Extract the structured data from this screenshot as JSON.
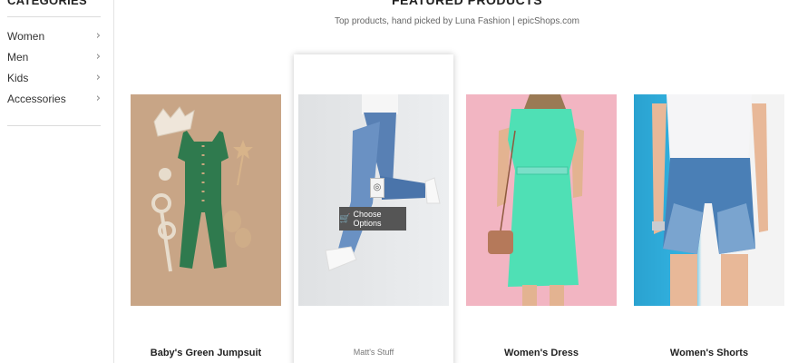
{
  "sidebar": {
    "title": "CATEGORIES",
    "items": [
      {
        "label": "Women"
      },
      {
        "label": "Men"
      },
      {
        "label": "Kids"
      },
      {
        "label": "Accessories"
      }
    ],
    "chevron": "›"
  },
  "featured": {
    "title": "FEATURED PRODUCTS",
    "subtitle": "Top products, hand picked by Luna Fashion | epicShops.com"
  },
  "products": [
    {
      "name": "Baby's Green Jumpsuit",
      "image": "green-jumpsuit-photo"
    },
    {
      "vendor": "Matt's Stuff",
      "image": "jeans-photo",
      "quick_view_icon": "eye-icon",
      "choose_label": "Choose Options",
      "cart_icon": "cart-icon"
    },
    {
      "name": "Women's Dress",
      "image": "mint-dress-photo"
    },
    {
      "name": "Women's Shorts",
      "image": "denim-shorts-photo"
    }
  ],
  "colors": {
    "button_bg": "#555555",
    "border": "#e4e4e4"
  }
}
